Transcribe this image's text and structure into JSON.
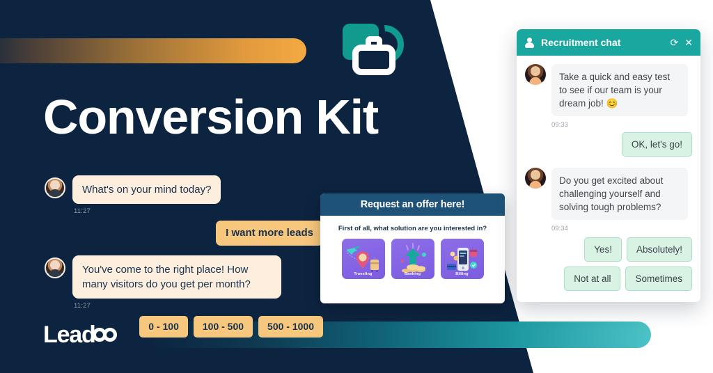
{
  "brand": {
    "logo_word": "Leadoo",
    "mark_icon": "briefcase-icon"
  },
  "headline": "Conversion Kit",
  "dark_chat": {
    "messages": [
      {
        "from": "bot",
        "text": "What's on your mind today?",
        "time": "11:27"
      },
      {
        "from": "user",
        "text": "I want more leads"
      },
      {
        "from": "bot",
        "text": "You've come to the right place! How many visitors do you get per month?",
        "time": "11:27"
      }
    ],
    "options": [
      "0 - 100",
      "100 - 500",
      "500 - 1000"
    ]
  },
  "offer_card": {
    "header": "Request an offer here!",
    "question": "First of all, what solution are you interested in?",
    "choices": [
      {
        "label": "Traveling"
      },
      {
        "label": "Banking"
      },
      {
        "label": "Billing"
      }
    ]
  },
  "recruitment_chat": {
    "title": "Recruitment chat",
    "person_icon": "person-icon",
    "refresh_icon": "refresh-icon",
    "close_icon": "close-icon",
    "refresh_glyph": "⟳",
    "close_glyph": "✕",
    "messages": [
      {
        "from": "bot",
        "text": "Take a quick and easy test to see if our team is your dream job! 😊",
        "time": "09:33"
      },
      {
        "from": "user",
        "text": "OK, let's go!"
      },
      {
        "from": "bot",
        "text": "Do you get excited about challenging yourself and solving tough problems?",
        "time": "09:34"
      }
    ],
    "answers": [
      "Yes!",
      "Absolutely!",
      "Not at all",
      "Sometimes"
    ]
  },
  "colors": {
    "navy": "#0d2440",
    "orange": "#f4a942",
    "teal": "#1aa7a0",
    "card_blue": "#1e5278",
    "purple": "#7c5ce0",
    "mint": "#d8f3e4"
  }
}
